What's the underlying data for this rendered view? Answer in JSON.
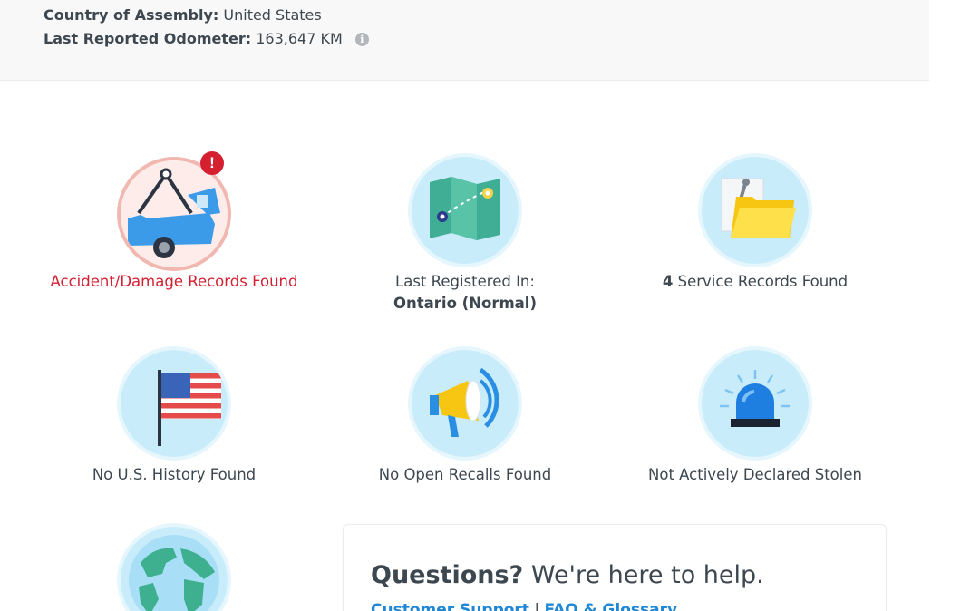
{
  "vehicle_info": {
    "assembly": {
      "label": "Country of Assembly:",
      "value": "United States"
    },
    "odometer": {
      "label": "Last Reported Odometer:",
      "value": "163,647 KM",
      "info_icon": "info-icon"
    }
  },
  "tiles": {
    "accident": {
      "caption": "Accident/Damage Records Found",
      "icon": "tow-truck-icon",
      "alert": "!",
      "status_color": "#d42030"
    },
    "registered": {
      "caption_line1": "Last Registered In:",
      "caption_line2": "Ontario (Normal)",
      "icon": "map-icon"
    },
    "service": {
      "count": "4",
      "caption": "Service Records Found",
      "icon": "service-folder-icon"
    },
    "us_history": {
      "caption": "No U.S. History Found",
      "icon": "us-flag-icon"
    },
    "recalls": {
      "caption": "No Open Recalls Found",
      "icon": "megaphone-icon"
    },
    "stolen": {
      "caption": "Not Actively Declared Stolen",
      "icon": "siren-icon"
    },
    "global": {
      "icon": "globe-icon"
    }
  },
  "help": {
    "title_strong": "Questions?",
    "title_rest": "We're here to help.",
    "support_link": "Customer Support",
    "separator": "|",
    "faq_link": "FAQ & Glossary"
  },
  "colors": {
    "link": "#1f87d6",
    "alert": "#d42030",
    "icon_bg": "#c9ecfb"
  }
}
